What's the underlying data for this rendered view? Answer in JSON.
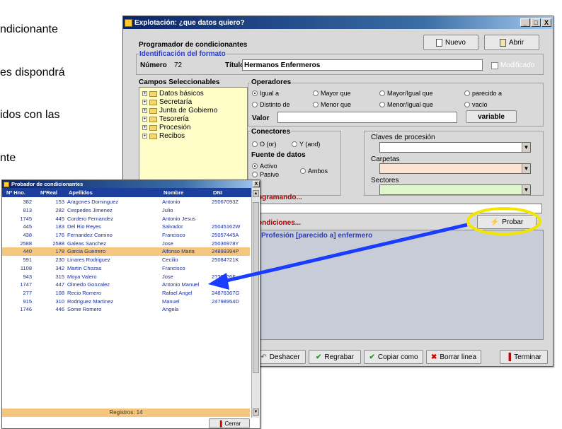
{
  "doc_text": [
    "ndicionante",
    "es  dispondrá",
    "idos  con  las",
    "nte"
  ],
  "main_window": {
    "title": "Explotación: ¿que datos quiero?",
    "title_buttons": [
      "_",
      "□",
      "X"
    ],
    "header": "Programador de condicionantes",
    "nuevo": "Nuevo",
    "abrir": "Abrir",
    "format_section": "Identificación del formato",
    "numero_label": "Número",
    "numero_value": "72",
    "titulo_label": "Título",
    "titulo_value": "Hermanos Enfermeros",
    "modificado": "Modificado",
    "campos_title": "Campos Seleccionables",
    "campos": [
      "Datos básicos",
      "Secretaría",
      "Junta de Gobierno",
      "Tesorería",
      "Procesión",
      "Recibos"
    ],
    "operadores_title": "Operadores",
    "operadores": [
      "Igual a",
      "Mayor que",
      "Mayor/Igual que",
      "parecido a",
      "Distinto de",
      "Menor que",
      "Menor/Igual que",
      "vacío"
    ],
    "selected_operator": "Igual a",
    "valor_label": "Valor",
    "variable_button": "variable",
    "conectores_title": "Conectores",
    "conector_o": "O (or)",
    "conector_y": "Y (and)",
    "fuente_title": "Fuente de datos",
    "fuente_activo": "Activo",
    "fuente_pasivo": "Pasivo",
    "fuente_ambos": "Ambos",
    "claves_label": "Claves de procesión",
    "carpetas_label": "Carpetas",
    "sectores_label": "Sectores",
    "programando": "ogramando...",
    "condiciones": "ondiciones...",
    "probar": "Probar",
    "condition_text": "Profesión [parecido a] enfermero",
    "bottom_buttons": [
      "Deshacer",
      "Regrabar",
      "Copiar como",
      "Borrar linea",
      "Terminar"
    ]
  },
  "tester_window": {
    "title": "Probador de condicionantes",
    "columns": [
      "Nº Hno.",
      "NºReal",
      "Apellidos",
      "Nombre",
      "DNI"
    ],
    "rows": [
      [
        "382",
        "153",
        "Aragones Dominguez",
        "Antonio",
        "25067093Z"
      ],
      [
        "813",
        "282",
        "Cespedes Jimenez",
        "Julio",
        ""
      ],
      [
        "1745",
        "445",
        "Cordero Fernandez",
        "Antonio Jesus",
        ""
      ],
      [
        "445",
        "183",
        "Del Rio Reyes",
        "Salvador",
        "25045162W"
      ],
      [
        "438",
        "176",
        "Fernandez Camino",
        "Francisco",
        "25057445A"
      ],
      [
        "2588",
        "2588",
        "Galeas Sanchez",
        "Jose",
        "25036978Y"
      ],
      [
        "440",
        "178",
        "Garcia Guerrero",
        "Alfonso Maria",
        "24899394P"
      ],
      [
        "591",
        "230",
        "Linares Rodriguez",
        "Cecilio",
        "25084?21K"
      ],
      [
        "1108",
        "342",
        "Martin Chozas",
        "Francisco",
        ""
      ],
      [
        "943",
        "315",
        "Moya Valero",
        "Jose",
        "2?????6F"
      ],
      [
        "1747",
        "447",
        "Olmedo Gonzalez",
        "Antonio Manuel",
        ""
      ],
      [
        "277",
        "108",
        "Recio Romero",
        "Rafael Angel",
        "24876367G"
      ],
      [
        "915",
        "310",
        "Rodriguez Martinez",
        "Manuel",
        "24798954D"
      ],
      [
        "1746",
        "446",
        "Some Romero",
        "Angela",
        ""
      ]
    ],
    "highlighted_row": 6,
    "registros": "Registros: 14",
    "cerrar": "Cerrar"
  },
  "colors": {
    "title_blue": "#0a246a",
    "header_row": "#1c3e9c",
    "highlight": "#f5c77e",
    "program_red": "#b00000",
    "annotation_yellow": "#f2e600",
    "arrow_blue": "#1a3cff"
  }
}
